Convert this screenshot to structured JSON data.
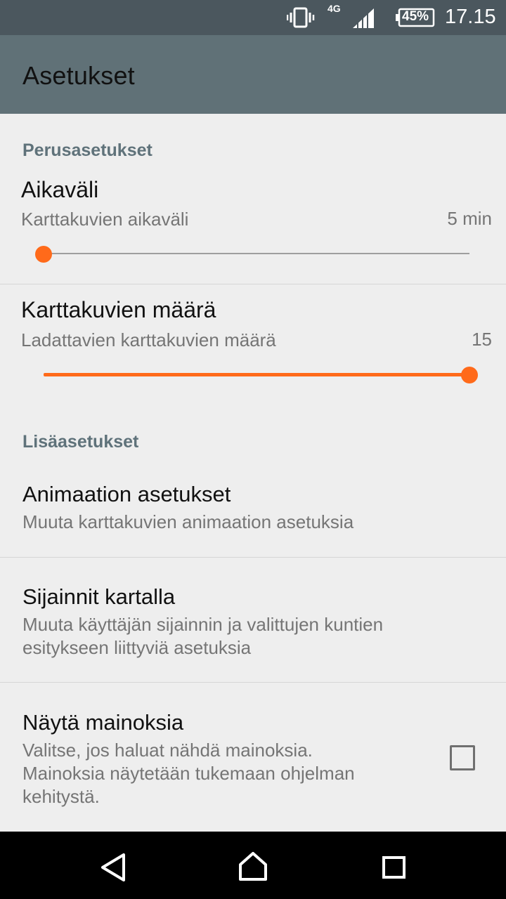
{
  "status_bar": {
    "network": "4G",
    "battery": "45%",
    "time": "17.15",
    "icons": [
      "vibrate-icon",
      "signal-icon",
      "battery-icon"
    ]
  },
  "app_bar": {
    "title": "Asetukset"
  },
  "sections": {
    "basic": {
      "header": "Perusasetukset",
      "interval": {
        "title": "Aikaväli",
        "summary": "Karttakuvien aikaväli",
        "value": "5 min",
        "slider_fraction": 0.0
      },
      "count": {
        "title": "Karttakuvien määrä",
        "summary": "Ladattavien karttakuvien määrä",
        "value": "15",
        "slider_fraction": 1.0
      }
    },
    "advanced": {
      "header": "Lisäasetukset",
      "animation": {
        "title": "Animaation asetukset",
        "summary": "Muuta karttakuvien animaation asetuksia"
      },
      "locations": {
        "title": "Sijainnit kartalla",
        "summary_line1": "Muuta käyttäjän sijainnin ja valittujen kuntien",
        "summary_line2": "esitykseen liittyviä asetuksia"
      },
      "ads": {
        "title": "Näytä mainoksia",
        "summary_line1": "Valitse, jos haluat nähdä mainoksia.",
        "summary_line2": "Mainoksia näytetään tukemaan ohjelman",
        "summary_line3": "kehitystä.",
        "checked": false
      }
    }
  },
  "nav_bar": {
    "icons": [
      "back-icon",
      "home-icon",
      "recents-icon"
    ]
  },
  "colors": {
    "accent": "#ff6a1a",
    "app_bar": "#607177",
    "status_bar": "#4b575e",
    "section_header": "#5f727a"
  }
}
